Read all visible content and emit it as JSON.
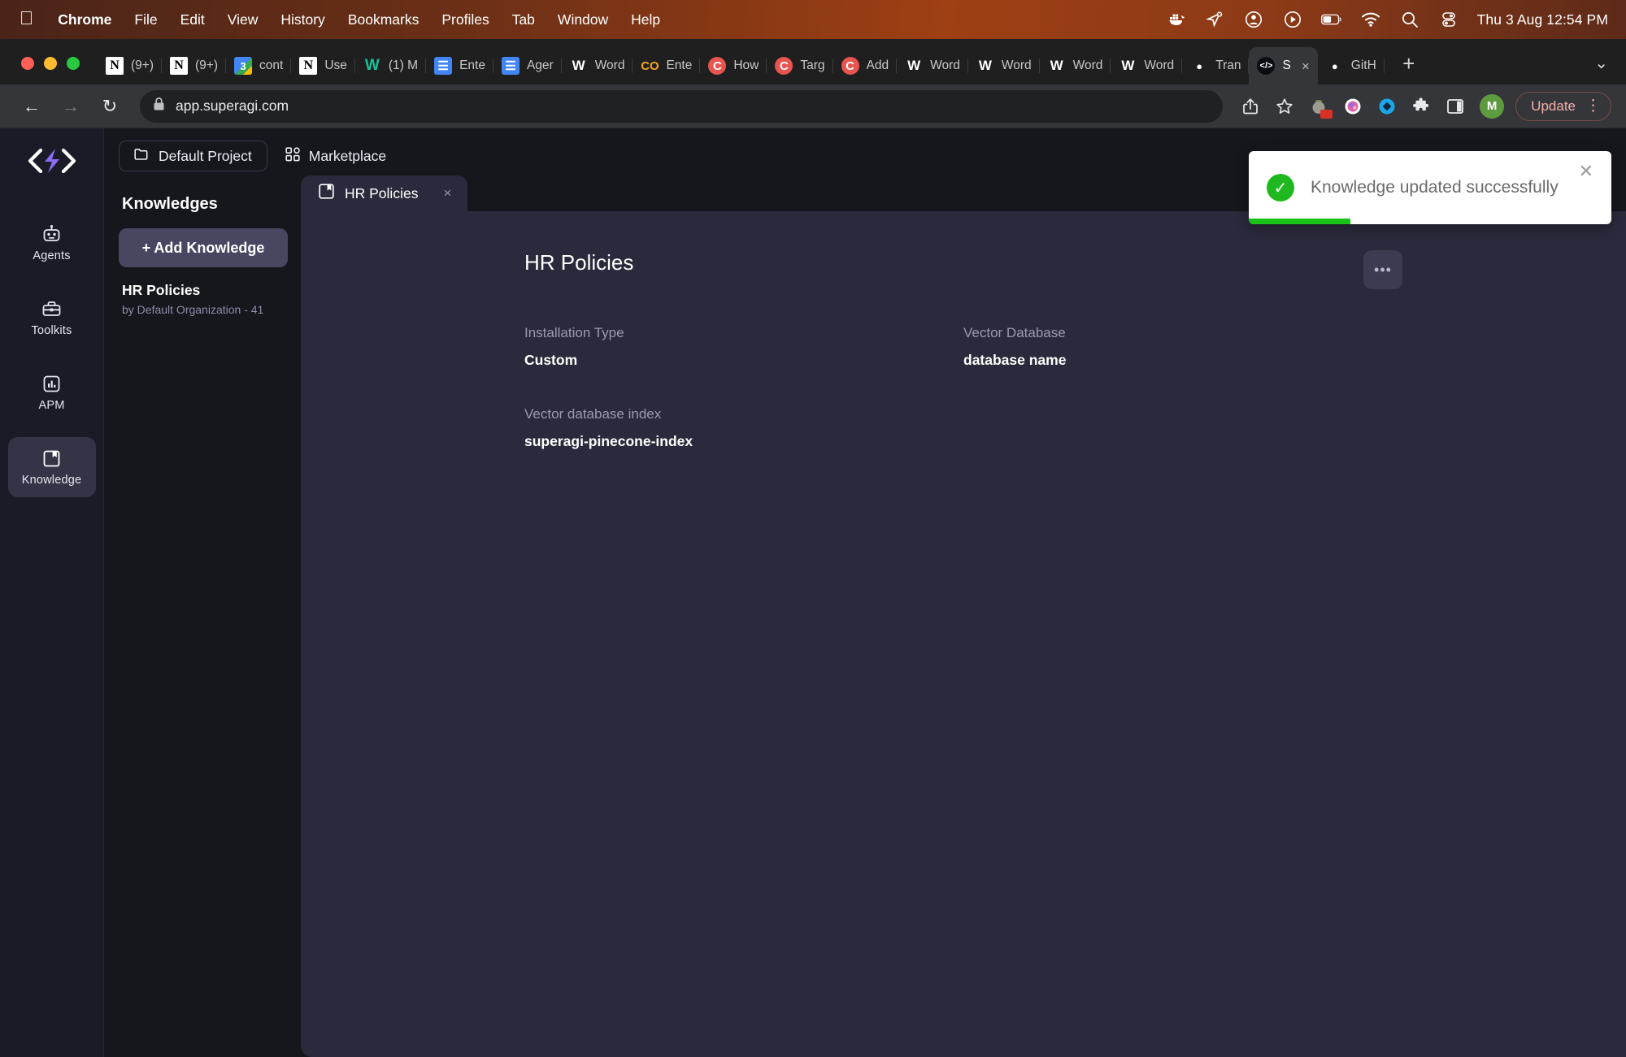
{
  "menubar": {
    "apple_icon": "apple-logo",
    "items": [
      {
        "label": "Chrome",
        "bold": true
      },
      {
        "label": "File",
        "bold": false
      },
      {
        "label": "Edit",
        "bold": false
      },
      {
        "label": "View",
        "bold": false
      },
      {
        "label": "History",
        "bold": false
      },
      {
        "label": "Bookmarks",
        "bold": false
      },
      {
        "label": "Profiles",
        "bold": false
      },
      {
        "label": "Tab",
        "bold": false
      },
      {
        "label": "Window",
        "bold": false
      },
      {
        "label": "Help",
        "bold": false
      }
    ],
    "status_icons": [
      "docker-icon",
      "location-pin-off-icon",
      "user-account-icon",
      "play-circle-icon",
      "battery-icon",
      "wifi-icon",
      "search-icon",
      "control-center-icon"
    ],
    "clock": "Thu 3 Aug  12:54 PM"
  },
  "browser": {
    "tabs": [
      {
        "label": "(9+)",
        "favicon": "notion-icon",
        "fav_class": "notion",
        "fav_glyph": "N",
        "active": false
      },
      {
        "label": "(9+)",
        "favicon": "notion-icon",
        "fav_class": "notion",
        "fav_glyph": "N",
        "active": false
      },
      {
        "label": "cont",
        "favicon": "google-slides-icon",
        "fav_class": "gslide",
        "fav_glyph": "3",
        "active": false
      },
      {
        "label": "Use",
        "favicon": "notion-icon",
        "fav_class": "notion",
        "fav_glyph": "N",
        "active": false
      },
      {
        "label": "(1) M",
        "favicon": "grammarly-icon",
        "fav_class": "grammarly",
        "fav_glyph": "W",
        "active": false
      },
      {
        "label": "Ente",
        "favicon": "google-docs-icon",
        "fav_class": "gdoc",
        "fav_glyph": "☰",
        "active": false
      },
      {
        "label": "Ager",
        "favicon": "google-docs-icon",
        "fav_class": "gdoc",
        "fav_glyph": "☰",
        "active": false
      },
      {
        "label": "Word",
        "favicon": "ms-word-icon",
        "fav_class": "word",
        "fav_glyph": "W",
        "active": false
      },
      {
        "label": "Ente",
        "favicon": "coda-icon",
        "fav_class": "coda",
        "fav_glyph": "CO",
        "active": false
      },
      {
        "label": "How",
        "favicon": "coursera-icon",
        "fav_class": "coursera",
        "fav_glyph": "C",
        "active": false
      },
      {
        "label": "Targ",
        "favicon": "coursera-icon",
        "fav_class": "coursera",
        "fav_glyph": "C",
        "active": false
      },
      {
        "label": "Add",
        "favicon": "coursera-icon",
        "fav_class": "coursera",
        "fav_glyph": "C",
        "active": false
      },
      {
        "label": "Word",
        "favicon": "ms-word-icon",
        "fav_class": "word",
        "fav_glyph": "W",
        "active": false
      },
      {
        "label": "Word",
        "favicon": "ms-word-icon",
        "fav_class": "word",
        "fav_glyph": "W",
        "active": false
      },
      {
        "label": "Word",
        "favicon": "ms-word-icon",
        "fav_class": "word",
        "fav_glyph": "W",
        "active": false
      },
      {
        "label": "Word",
        "favicon": "ms-word-icon",
        "fav_class": "word",
        "fav_glyph": "W",
        "active": false
      },
      {
        "label": "Tran",
        "favicon": "github-icon",
        "fav_class": "github",
        "fav_glyph": "●",
        "active": false
      },
      {
        "label": "S",
        "favicon": "superagi-icon",
        "fav_class": "superagi",
        "fav_glyph": "</>",
        "active": true
      },
      {
        "label": "GitH",
        "favicon": "github-icon",
        "fav_class": "github",
        "fav_glyph": "●",
        "active": false
      }
    ],
    "new_tab_label": "+",
    "tab_list_chevron": "⌄",
    "back_label": "←",
    "forward_label": "→",
    "reload_label": "↻",
    "lock_icon": "lock-icon",
    "url": "app.superagi.com",
    "share_icon": "share-icon",
    "bookmark_icon": "star-icon",
    "extensions": [
      "tomato-timer-icon",
      "colorful-circle-icon",
      "blue-diamond-icon",
      "puzzle-icon",
      "side-panel-icon"
    ],
    "profile_initial": "M",
    "update_label": "Update",
    "menu_icon": "kebab-menu-icon"
  },
  "app": {
    "logo": "superagi-logo",
    "rail": [
      {
        "label": "Agents",
        "icon": "robot-icon",
        "active": false
      },
      {
        "label": "Toolkits",
        "icon": "toolbox-icon",
        "active": false
      },
      {
        "label": "APM",
        "icon": "bar-chart-icon",
        "active": false
      },
      {
        "label": "Knowledge",
        "icon": "book-icon",
        "active": true
      }
    ],
    "topbar": {
      "project_label": "Default Project",
      "project_icon": "folder-icon",
      "marketplace_label": "Marketplace",
      "marketplace_icon": "grid-icon"
    },
    "knowledge_panel": {
      "title": "Knowledges",
      "add_button_label": "+ Add Knowledge",
      "items": [
        {
          "title": "HR Policies",
          "subtitle": "by Default Organization - 41"
        }
      ]
    },
    "content_tab": {
      "label": "HR Policies",
      "icon": "book-icon",
      "close_label": "×"
    },
    "detail": {
      "title": "HR Policies",
      "more_label": "•••",
      "fields": [
        {
          "label": "Installation Type",
          "value": "Custom"
        },
        {
          "label": "Vector Database",
          "value": "database name"
        },
        {
          "label": "Vector database index",
          "value": "superagi-pinecone-index"
        }
      ]
    }
  },
  "toast": {
    "message": "Knowledge updated successfully",
    "check_icon": "check-circle-icon",
    "close_label": "✕",
    "progress_percent": 28,
    "accent_color": "#18c218"
  }
}
